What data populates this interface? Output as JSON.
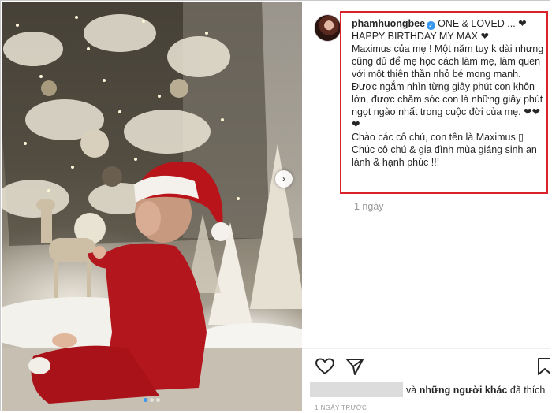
{
  "post": {
    "username": "phamhuongbee",
    "verified_icon": "verified-badge-icon",
    "caption_head": "ONE & LOVED ... ❤",
    "caption_lines": [
      "HAPPY BIRTHDAY MY MAX ❤",
      "Maximus của mẹ ! Một năm tuy k dài nhưng cũng đủ để mẹ học cách làm mẹ, làm quen với một thiên thần nhỏ bé mong manh. Được ngắm nhìn từng giây phút con khôn lớn, được chăm sóc con là những giây phút ngọt ngào nhất trong cuộc đời của mẹ. ❤❤❤",
      "Chào các cô chú, con tên là Maximus ▯ Chúc cô chú & gia đình mùa giáng sinh an lành & hạnh phúc !!!"
    ],
    "comment_time": "1 ngày",
    "likes_prefix": "và",
    "likes_others": "những người khác",
    "likes_suffix": "đã thích",
    "post_date": "1 NGÀY TRƯỚC"
  },
  "carousel": {
    "next_glyph": "›",
    "slide_count": 3,
    "active_index": 0
  },
  "colors": {
    "highlight_border": "#d8232a",
    "verified": "#3897f0",
    "muted_text": "#999999"
  },
  "icons": [
    "heart-icon",
    "share-icon",
    "bookmark-icon",
    "chevron-right-icon"
  ]
}
